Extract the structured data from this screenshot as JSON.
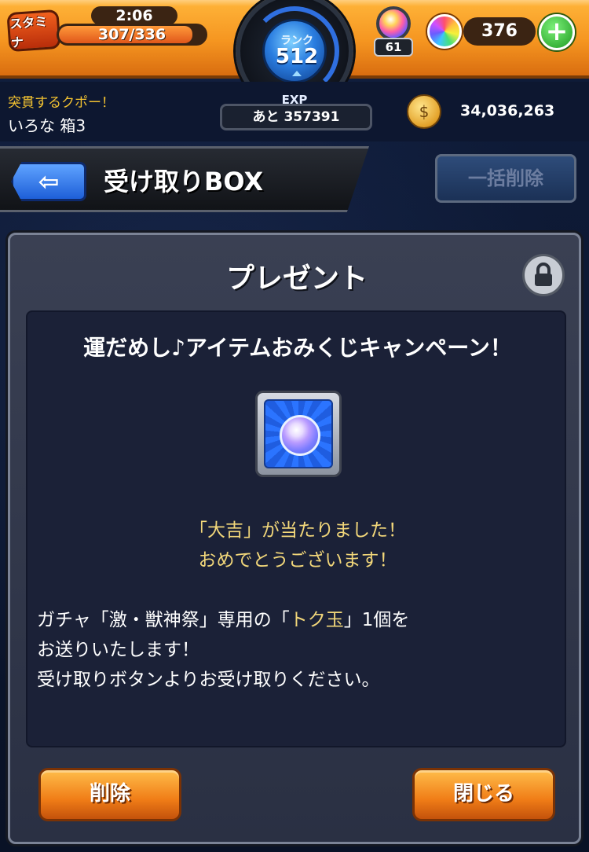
{
  "top_bar": {
    "stamina_badge": "スタミナ",
    "stamina_timer": "2:06",
    "stamina_value": "307/336",
    "stamina_fill_fraction": 0.914,
    "rank_label": "ランク",
    "rank_value": "512",
    "orb_slot_count": "61",
    "orb_count": "376",
    "plus_label": "+"
  },
  "status_row": {
    "caption": "突貫するクポー！",
    "subtitle": "いろな 箱3",
    "exp_label": "EXP",
    "exp_remaining": "あと 357391",
    "coin_count": "34,036,263"
  },
  "header": {
    "back_glyph": "⇦",
    "title": "受け取りBOX",
    "bulk_delete_label": "一括削除"
  },
  "dialog": {
    "title": "プレゼント",
    "campaign_title": "運だめし♪アイテムおみくじキャンペーン！",
    "result_line_1": "「大吉」が当たりました！",
    "result_line_2": "おめでとうございます！",
    "body_line_1_prefix": "ガチャ「激・獣神祭」専用の「",
    "body_line_1_highlight": "トク玉",
    "body_line_1_suffix": "」1個を",
    "body_line_2": "お送りいたします！",
    "body_line_3": "受け取りボタンよりお受け取りください。",
    "delete_label": "削除",
    "close_label": "閉じる"
  },
  "colors": {
    "topbar_orange": "#f59520",
    "highlight_gold": "#f2d77a",
    "caption_gold": "#f2c231",
    "back_blue": "#1e5fd8",
    "dialog_bg": "#2a3043"
  },
  "icons": {
    "stamina": "flame-badge-icon",
    "orb_slot": "orb-slot-icon",
    "orb": "rainbow-orb-icon",
    "plus": "plus-icon",
    "coin": "coin-icon",
    "back": "back-arrow-icon",
    "lock": "lock-icon",
    "item": "toku-orb-item-icon"
  }
}
